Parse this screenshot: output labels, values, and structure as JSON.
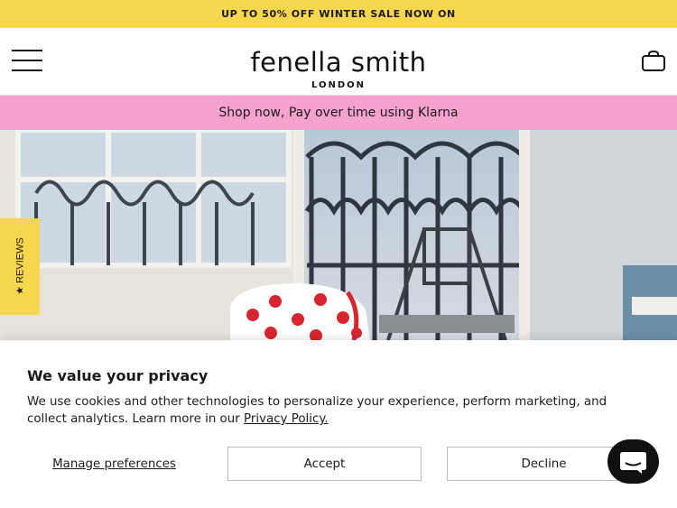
{
  "announcement": {
    "text": "UP TO 50% OFF WINTER SALE NOW ON"
  },
  "header": {
    "logo_main": "fenella smith",
    "logo_sub": "LONDON",
    "menu_icon": "hamburger-menu-icon",
    "bag_icon": "shopping-bag-icon"
  },
  "klarna_banner": {
    "text": "Shop now, Pay over time using Klarna"
  },
  "reviews_tab": {
    "label": "★ REVIEWS"
  },
  "privacy": {
    "title": "We value your privacy",
    "body": "We use cookies and other technologies to personalize your experience, perform marketing, and collect analytics. Learn more in our ",
    "link": "Privacy Policy.",
    "manage_label": "Manage preferences",
    "accept_label": "Accept",
    "decline_label": "Decline"
  },
  "chat": {
    "icon": "chat-bubble-icon"
  },
  "colors": {
    "announcement_bg": "#f8d64e",
    "klarna_bg": "#f5a2cf",
    "chat_bg": "#111111"
  }
}
